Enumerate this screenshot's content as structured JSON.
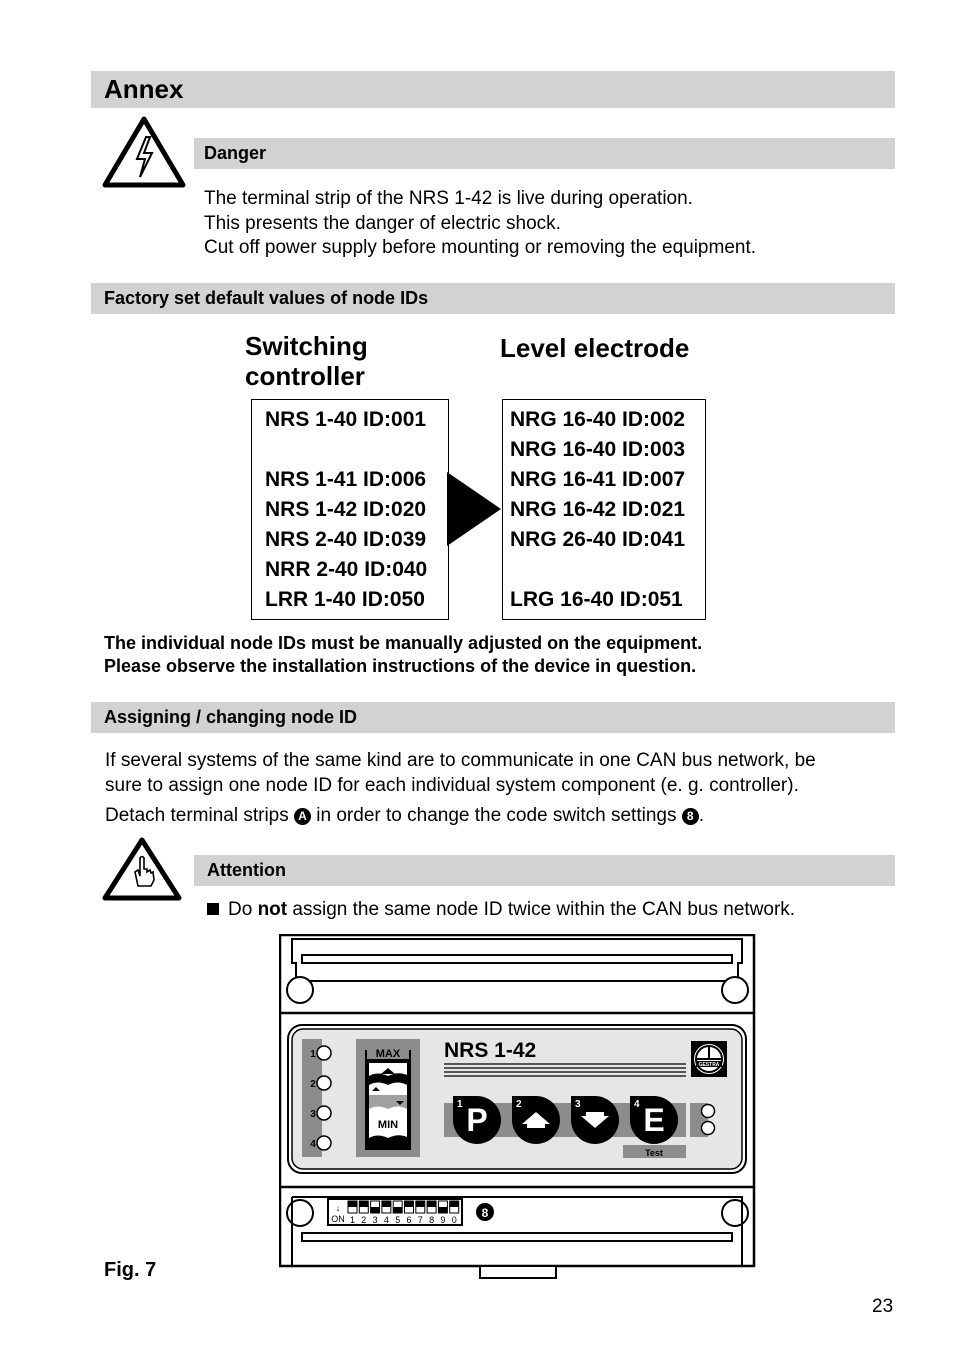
{
  "annex": {
    "title": "Annex"
  },
  "danger": {
    "icon": "electric-shock-warning-icon",
    "title": "Danger",
    "lines": [
      "The terminal strip of the NRS 1-42 is live during operation.",
      "This presents the danger of electric shock.",
      "Cut off power supply before mounting or removing the equipment."
    ]
  },
  "factory": {
    "title": "Factory set default values of node IDs",
    "left_heading": [
      "Switching",
      "controller"
    ],
    "right_heading": "Level electrode",
    "left_ids": [
      "NRS 1-40 ID:001",
      "",
      "NRS 1-41 ID:006",
      "NRS 1-42 ID:020",
      "NRS 2-40 ID:039",
      "NRR 2-40 ID:040",
      "LRR 1-40 ID:050"
    ],
    "right_ids": [
      "NRG 16-40 ID:002",
      "NRG 16-40 ID:003",
      "NRG 16-41 ID:007",
      "NRG 16-42 ID:021",
      "NRG 26-40 ID:041",
      "",
      "LRG 16-40 ID:051"
    ],
    "notes": [
      "The individual node IDs must be manually adjusted on the equipment.",
      "Please observe the installation instructions of the device in question."
    ]
  },
  "assigning": {
    "title": "Assigning / changing node ID",
    "para": [
      "If several systems of the same kind are to communicate in one CAN bus network, be",
      "sure to assign one node ID for each individual system component (e. g. controller)."
    ],
    "detach_pre": "Detach terminal strips",
    "marker_a": "A",
    "detach_mid": "in order to change the code switch settings",
    "marker_8": "8",
    "detach_post": "."
  },
  "attention": {
    "icon": "hand-attention-icon",
    "title": "Attention",
    "bullet_pre": "Do ",
    "bullet_bold": "not",
    "bullet_post": " assign the same node ID twice within the CAN bus network."
  },
  "figure": {
    "device_label": "NRS 1-42",
    "led_numbers": [
      "1",
      "2",
      "3",
      "4"
    ],
    "max_label": "MAX",
    "min_label": "MIN",
    "buttons": [
      {
        "num": "1",
        "label": "P"
      },
      {
        "num": "2",
        "label": "up-arrow-icon"
      },
      {
        "num": "3",
        "label": "down-arrow-icon"
      },
      {
        "num": "4",
        "label": "E"
      }
    ],
    "test_label": "Test",
    "logo_text": "GESTRA",
    "dip_on": "ON",
    "dip_numbers": [
      "1",
      "2",
      "3",
      "4",
      "5",
      "6",
      "7",
      "8",
      "9",
      "0"
    ],
    "dip_marker": "8",
    "caption": "Fig. 7"
  },
  "page_number": "23"
}
